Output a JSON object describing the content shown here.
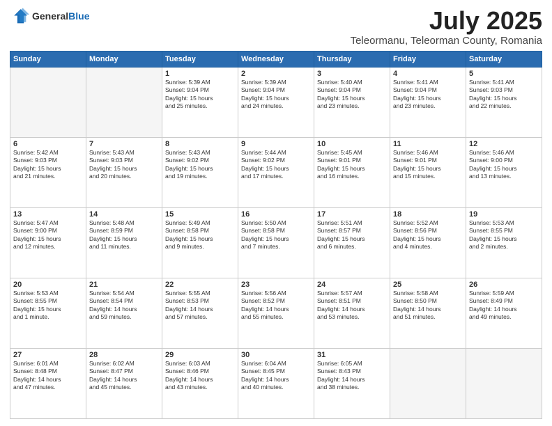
{
  "header": {
    "logo_general": "General",
    "logo_blue": "Blue",
    "month": "July 2025",
    "location": "Teleormanu, Teleorman County, Romania"
  },
  "days_of_week": [
    "Sunday",
    "Monday",
    "Tuesday",
    "Wednesday",
    "Thursday",
    "Friday",
    "Saturday"
  ],
  "weeks": [
    [
      {
        "day": "",
        "text": ""
      },
      {
        "day": "",
        "text": ""
      },
      {
        "day": "1",
        "text": "Sunrise: 5:39 AM\nSunset: 9:04 PM\nDaylight: 15 hours\nand 25 minutes."
      },
      {
        "day": "2",
        "text": "Sunrise: 5:39 AM\nSunset: 9:04 PM\nDaylight: 15 hours\nand 24 minutes."
      },
      {
        "day": "3",
        "text": "Sunrise: 5:40 AM\nSunset: 9:04 PM\nDaylight: 15 hours\nand 23 minutes."
      },
      {
        "day": "4",
        "text": "Sunrise: 5:41 AM\nSunset: 9:04 PM\nDaylight: 15 hours\nand 23 minutes."
      },
      {
        "day": "5",
        "text": "Sunrise: 5:41 AM\nSunset: 9:03 PM\nDaylight: 15 hours\nand 22 minutes."
      }
    ],
    [
      {
        "day": "6",
        "text": "Sunrise: 5:42 AM\nSunset: 9:03 PM\nDaylight: 15 hours\nand 21 minutes."
      },
      {
        "day": "7",
        "text": "Sunrise: 5:43 AM\nSunset: 9:03 PM\nDaylight: 15 hours\nand 20 minutes."
      },
      {
        "day": "8",
        "text": "Sunrise: 5:43 AM\nSunset: 9:02 PM\nDaylight: 15 hours\nand 19 minutes."
      },
      {
        "day": "9",
        "text": "Sunrise: 5:44 AM\nSunset: 9:02 PM\nDaylight: 15 hours\nand 17 minutes."
      },
      {
        "day": "10",
        "text": "Sunrise: 5:45 AM\nSunset: 9:01 PM\nDaylight: 15 hours\nand 16 minutes."
      },
      {
        "day": "11",
        "text": "Sunrise: 5:46 AM\nSunset: 9:01 PM\nDaylight: 15 hours\nand 15 minutes."
      },
      {
        "day": "12",
        "text": "Sunrise: 5:46 AM\nSunset: 9:00 PM\nDaylight: 15 hours\nand 13 minutes."
      }
    ],
    [
      {
        "day": "13",
        "text": "Sunrise: 5:47 AM\nSunset: 9:00 PM\nDaylight: 15 hours\nand 12 minutes."
      },
      {
        "day": "14",
        "text": "Sunrise: 5:48 AM\nSunset: 8:59 PM\nDaylight: 15 hours\nand 11 minutes."
      },
      {
        "day": "15",
        "text": "Sunrise: 5:49 AM\nSunset: 8:58 PM\nDaylight: 15 hours\nand 9 minutes."
      },
      {
        "day": "16",
        "text": "Sunrise: 5:50 AM\nSunset: 8:58 PM\nDaylight: 15 hours\nand 7 minutes."
      },
      {
        "day": "17",
        "text": "Sunrise: 5:51 AM\nSunset: 8:57 PM\nDaylight: 15 hours\nand 6 minutes."
      },
      {
        "day": "18",
        "text": "Sunrise: 5:52 AM\nSunset: 8:56 PM\nDaylight: 15 hours\nand 4 minutes."
      },
      {
        "day": "19",
        "text": "Sunrise: 5:53 AM\nSunset: 8:55 PM\nDaylight: 15 hours\nand 2 minutes."
      }
    ],
    [
      {
        "day": "20",
        "text": "Sunrise: 5:53 AM\nSunset: 8:55 PM\nDaylight: 15 hours\nand 1 minute."
      },
      {
        "day": "21",
        "text": "Sunrise: 5:54 AM\nSunset: 8:54 PM\nDaylight: 14 hours\nand 59 minutes."
      },
      {
        "day": "22",
        "text": "Sunrise: 5:55 AM\nSunset: 8:53 PM\nDaylight: 14 hours\nand 57 minutes."
      },
      {
        "day": "23",
        "text": "Sunrise: 5:56 AM\nSunset: 8:52 PM\nDaylight: 14 hours\nand 55 minutes."
      },
      {
        "day": "24",
        "text": "Sunrise: 5:57 AM\nSunset: 8:51 PM\nDaylight: 14 hours\nand 53 minutes."
      },
      {
        "day": "25",
        "text": "Sunrise: 5:58 AM\nSunset: 8:50 PM\nDaylight: 14 hours\nand 51 minutes."
      },
      {
        "day": "26",
        "text": "Sunrise: 5:59 AM\nSunset: 8:49 PM\nDaylight: 14 hours\nand 49 minutes."
      }
    ],
    [
      {
        "day": "27",
        "text": "Sunrise: 6:01 AM\nSunset: 8:48 PM\nDaylight: 14 hours\nand 47 minutes."
      },
      {
        "day": "28",
        "text": "Sunrise: 6:02 AM\nSunset: 8:47 PM\nDaylight: 14 hours\nand 45 minutes."
      },
      {
        "day": "29",
        "text": "Sunrise: 6:03 AM\nSunset: 8:46 PM\nDaylight: 14 hours\nand 43 minutes."
      },
      {
        "day": "30",
        "text": "Sunrise: 6:04 AM\nSunset: 8:45 PM\nDaylight: 14 hours\nand 40 minutes."
      },
      {
        "day": "31",
        "text": "Sunrise: 6:05 AM\nSunset: 8:43 PM\nDaylight: 14 hours\nand 38 minutes."
      },
      {
        "day": "",
        "text": ""
      },
      {
        "day": "",
        "text": ""
      }
    ]
  ]
}
